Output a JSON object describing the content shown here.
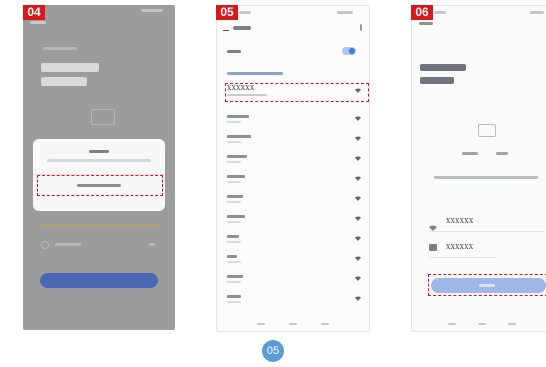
{
  "steps": {
    "step1_number": "04",
    "step2_number": "05",
    "step3_number": "06"
  },
  "screen05": {
    "selected_network": "XXXXXX"
  },
  "screen06": {
    "ssid_value": "XXXXXX",
    "password_value": "XXXXXX"
  },
  "page_number": "05",
  "colors": {
    "highlight": "#e2131a",
    "badge": "#d7191c",
    "primary_button": "#3c6cd9",
    "page_number_bg": "#5b9bd6"
  }
}
